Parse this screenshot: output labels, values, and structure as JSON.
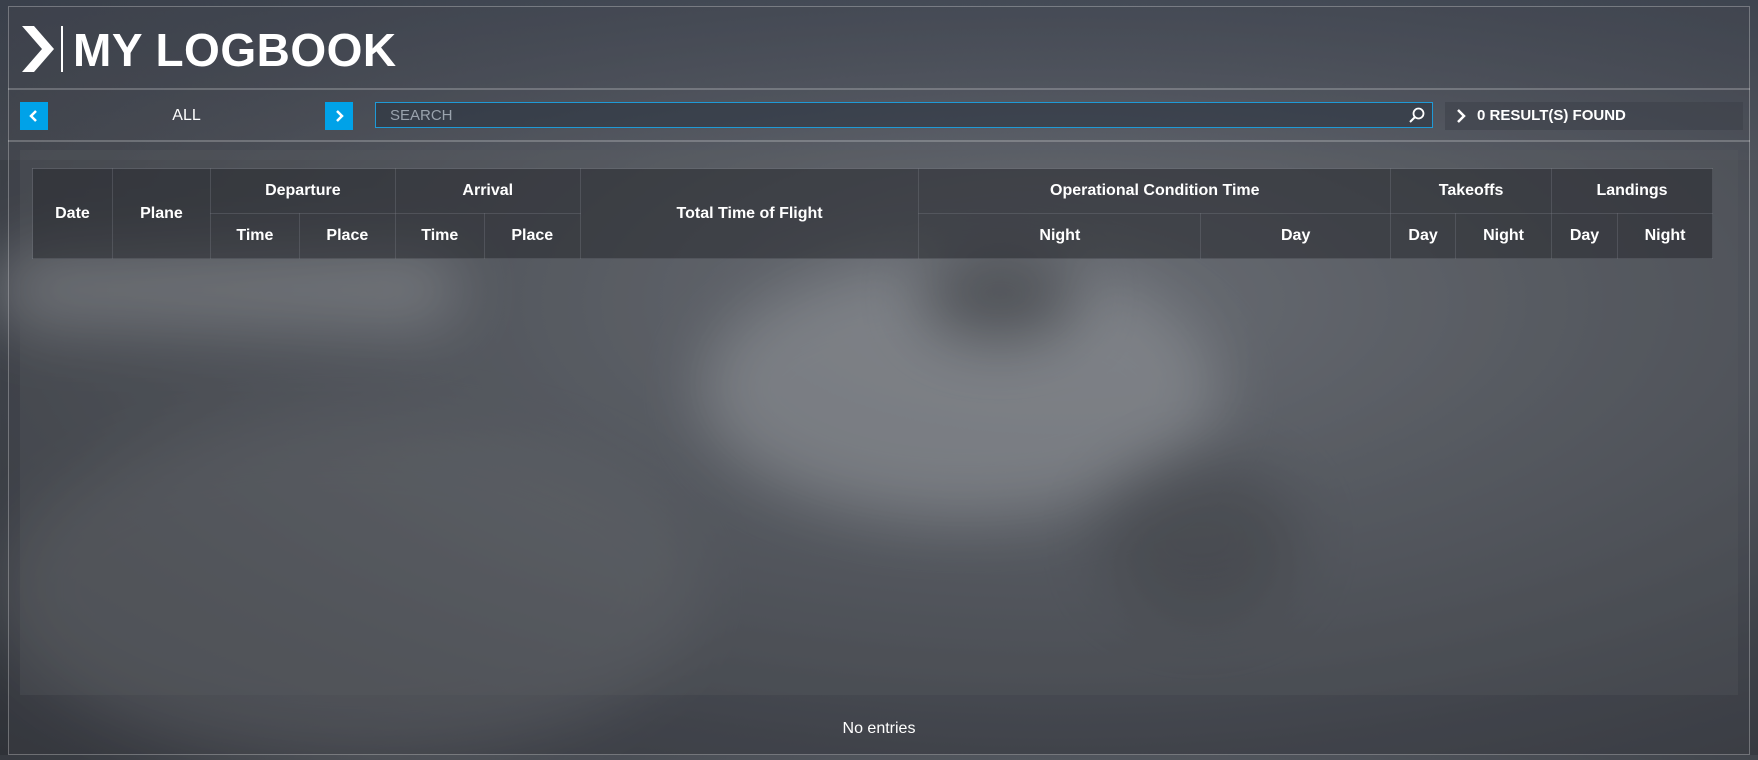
{
  "header": {
    "title": "MY LOGBOOK"
  },
  "filter": {
    "label": "ALL"
  },
  "search": {
    "placeholder": "SEARCH",
    "value": ""
  },
  "results": {
    "text": "0 RESULT(S) FOUND"
  },
  "table": {
    "headers": {
      "date": "Date",
      "plane": "Plane",
      "departure": "Departure",
      "departure_time": "Time",
      "departure_place": "Place",
      "arrival": "Arrival",
      "arrival_time": "Time",
      "arrival_place": "Place",
      "total_time": "Total Time of Flight",
      "operational": "Operational Condition Time",
      "operational_night": "Night",
      "operational_day": "Day",
      "takeoffs": "Takeoffs",
      "takeoffs_day": "Day",
      "takeoffs_night": "Night",
      "landings": "Landings",
      "landings_day": "Day",
      "landings_night": "Night"
    },
    "rows": []
  },
  "footer": {
    "empty_text": "No entries"
  },
  "colors": {
    "accent": "#00a2e8",
    "search_border": "#1f9ad6"
  }
}
